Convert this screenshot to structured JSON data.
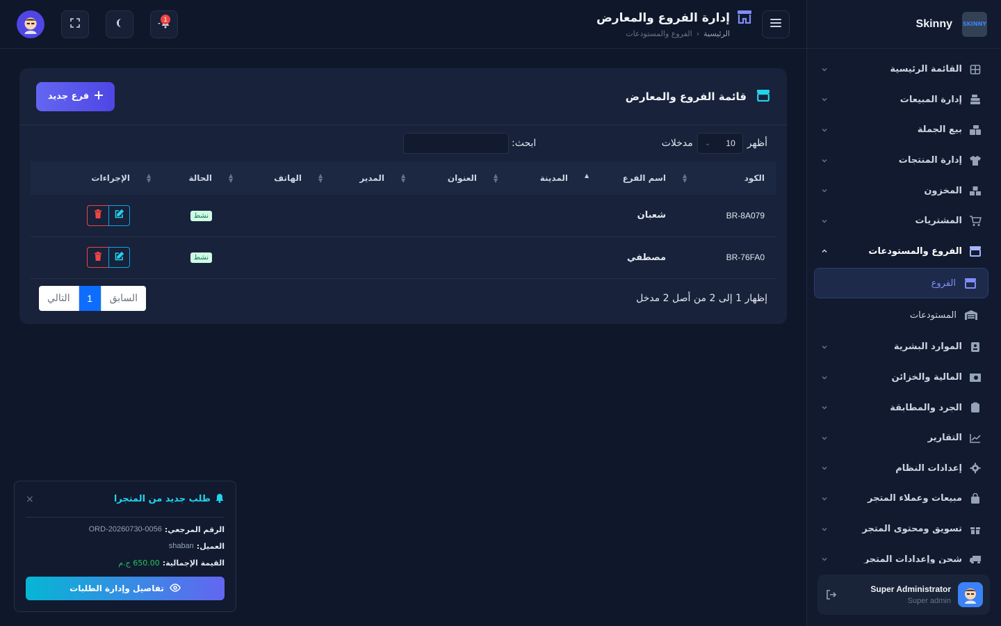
{
  "brand": {
    "name": "Skinny",
    "logo_text": "SKINNY"
  },
  "sidebar": {
    "items": [
      {
        "label": "القائمة الرئيسية",
        "icon": "grid-icon"
      },
      {
        "label": "إدارة المبيعات",
        "icon": "cash-register-icon"
      },
      {
        "label": "بيع الجملة",
        "icon": "boxes-icon"
      },
      {
        "label": "إدارة المنتجات",
        "icon": "shirt-icon"
      },
      {
        "label": "المخزون",
        "icon": "stack-boxes-icon"
      },
      {
        "label": "المشتريات",
        "icon": "cart-icon"
      },
      {
        "label": "الفروع والمستودعات",
        "icon": "store-icon",
        "open": true
      }
    ],
    "sub_items": [
      {
        "label": "الفروع",
        "icon": "store-icon",
        "active": true
      },
      {
        "label": "المستودعات",
        "icon": "warehouse-icon"
      }
    ],
    "items_after": [
      {
        "label": "الموارد البشرية",
        "icon": "id-badge-icon"
      },
      {
        "label": "المالية والخزائن",
        "icon": "money-icon"
      },
      {
        "label": "الجرد والمطابقة",
        "icon": "clipboard-icon"
      },
      {
        "label": "التقارير",
        "icon": "chart-line-icon"
      },
      {
        "label": "إعدادات النظام",
        "icon": "gear-icon"
      },
      {
        "label": "مبيعات وعملاء المتجر",
        "icon": "bag-icon"
      },
      {
        "label": "تسويق ومحتوى المتجر",
        "icon": "gift-icon"
      },
      {
        "label": "شحن وإعدادات المتجر",
        "icon": "truck-icon"
      }
    ]
  },
  "user": {
    "name": "Super Administrator",
    "role": "Super admin"
  },
  "header": {
    "title": "إدارة الفروع والمعارض",
    "breadcrumb_home": "الرئيسية",
    "breadcrumb_current": "الفروع والمستودعات",
    "notification_count": "1"
  },
  "card": {
    "title": "قائمة الفروع والمعارض",
    "new_button": "فرع جديد",
    "show_label": "أظهر",
    "entries_value": "10",
    "entries_label": "مدخلات",
    "search_label": "ابحث:",
    "columns": [
      "الكود",
      "اسم الفرع",
      "المدينة",
      "العنوان",
      "المدير",
      "الهاتف",
      "الحالة",
      "الإجراءات"
    ],
    "rows": [
      {
        "code": "BR-8A079",
        "name": "شعبان",
        "city": "",
        "address": "",
        "manager": "",
        "phone": "",
        "status": "نشط"
      },
      {
        "code": "BR-76FA0",
        "name": "مصطفي",
        "city": "",
        "address": "",
        "manager": "",
        "phone": "",
        "status": "نشط"
      }
    ],
    "info": "إظهار 1 إلى 2 من أصل 2 مدخل",
    "pager": {
      "prev": "السابق",
      "current": "1",
      "next": "التالي"
    }
  },
  "toast": {
    "title": "طلب جديد من المتجرا",
    "ref_label": "الرقم المرجعي:",
    "ref_value": "ORD-20260730-0056",
    "customer_label": "العميل:",
    "customer_value": "shaban",
    "total_label": "القيمة الإجمالية:",
    "total_value": "650.00 ج.م",
    "button": "تفاصيل وإدارة الطلبات"
  },
  "colors": {
    "accent": "#6366f1",
    "bg": "#0f172a",
    "success": "#22c55e",
    "danger": "#ef4444",
    "info": "#22d3ee"
  }
}
